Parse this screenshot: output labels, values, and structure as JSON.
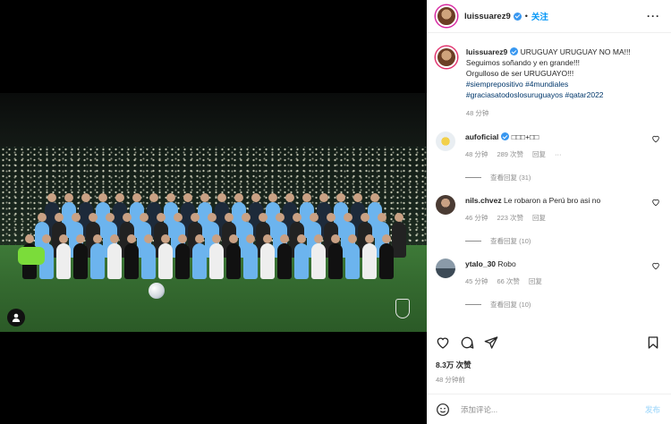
{
  "post": {
    "username": "luissuarez9",
    "follow_label": "关注",
    "more_label": "···",
    "caption_user": "luissuarez9",
    "caption_lines": [
      "URUGUAY URUGUAY NO MA!!!",
      "Seguimos soñando y en grande!!!",
      "Orgulloso de ser URUGUAYO!!!"
    ],
    "hashtags_line1": [
      "#siemprepositivo",
      "#4mundiales"
    ],
    "hashtags_line2": [
      "#graciasatodoslosuruguayos",
      "#qatar2022"
    ],
    "caption_time": "48 分钟"
  },
  "comments": [
    {
      "user": "aufoficial",
      "text": "□□□+□□",
      "time": "48 分钟",
      "likes": "289 次赞",
      "reply": "回复",
      "more": "···",
      "view_replies": "查看回复 (31)"
    },
    {
      "user": "nils.chvez",
      "text": "Le robaron a Perú bro asi no",
      "time": "46 分钟",
      "likes": "223 次赞",
      "reply": "回复",
      "view_replies": "查看回复 (10)"
    },
    {
      "user": "ytalo_30",
      "text": "Robo",
      "time": "45 分钟",
      "likes": "66 次赞",
      "reply": "回复",
      "view_replies": "查看回复 (10)"
    }
  ],
  "footer": {
    "likes": "8.3万 次赞",
    "time": "48 分钟前",
    "comment_placeholder": "添加评论...",
    "post_label": "发布"
  },
  "colors": {
    "accent_blue": "#0095f6",
    "verified_blue": "#3897f0",
    "hashtag": "#00376b",
    "muted": "#8e8e8e",
    "uruguay_sky": "#6cb4ee"
  }
}
